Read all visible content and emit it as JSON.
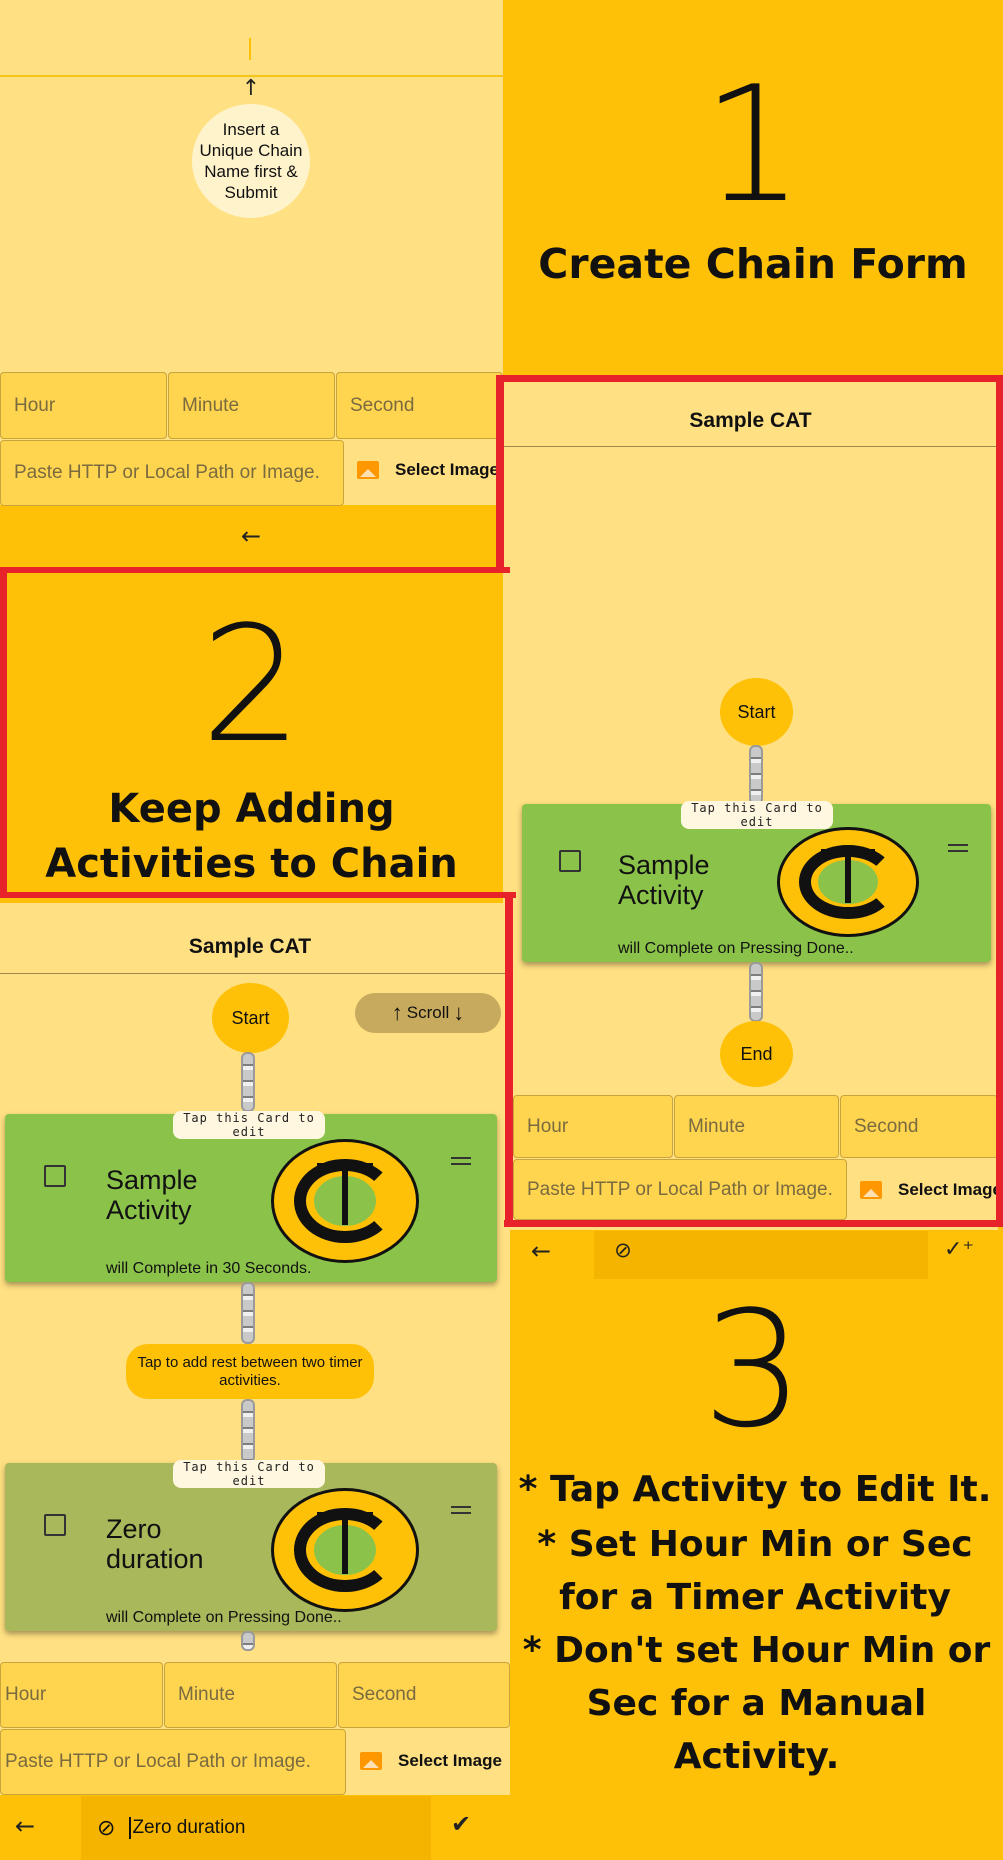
{
  "panel1": {
    "hint_bubble": "Insert a Unique Chain Name first & Submit",
    "time_fields": {
      "hour": "Hour",
      "minute": "Minute",
      "second": "Second"
    },
    "image_path_placeholder": "Paste HTTP or Local Path or Image.",
    "select_image_label": "Select Image"
  },
  "step1": {
    "number": "1",
    "caption": "Create Chain Form"
  },
  "step2": {
    "number": "2",
    "caption": "Keep Adding Activities to Chain"
  },
  "step3": {
    "number": "3",
    "instructions": [
      "* Tap Activity to Edit It.",
      "* Set Hour Min or Sec for a Timer Activity",
      "* Don't set Hour Min or Sec for a Manual Activity."
    ]
  },
  "panel2": {
    "title": "Sample CAT",
    "start_label": "Start",
    "end_label": "End",
    "tap_note": "Tap this Card to edit",
    "card": {
      "title": "Sample Activity",
      "subtitle": "will Complete on Pressing Done.."
    },
    "time_fields": {
      "hour": "Hour",
      "minute": "Minute",
      "second": "Second"
    },
    "image_path_placeholder": "Paste HTTP or Local Path or Image.",
    "select_image_label": "Select Image"
  },
  "panel3": {
    "title": "Sample CAT",
    "start_label": "Start",
    "scroll_label": "Scroll",
    "rest_label": "Tap to add rest between two timer activities.",
    "cards": [
      {
        "tap_note": "Tap this Card to edit",
        "title": "Sample Activity",
        "subtitle": "will Complete in 30 Seconds."
      },
      {
        "tap_note": "Tap this Card to edit",
        "title": "Zero duration",
        "subtitle": "will Complete on Pressing Done.."
      }
    ],
    "time_fields": {
      "hour": "Hour",
      "minute": "Minute",
      "second": "Second"
    },
    "image_path_placeholder": "Paste HTTP or Local Path or Image.",
    "select_image_label": "Select Image",
    "bottom_input_value": "Zero duration"
  },
  "colors": {
    "amber": "#ffc107",
    "light_amber": "#ffe082",
    "card_green": "#8bc34a",
    "frame_red": "#e8222b"
  },
  "icons": [
    "arrow-up-icon",
    "arrow-left-icon",
    "image-icon",
    "timer-off-icon",
    "add-task-icon",
    "done-all-icon",
    "arrow-down-icon"
  ]
}
